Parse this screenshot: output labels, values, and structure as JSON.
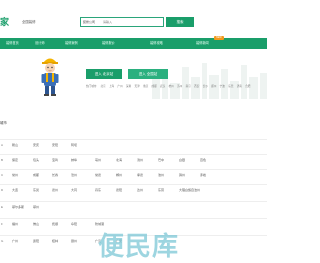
{
  "header": {
    "logo": "家",
    "city_pick": "全国装修",
    "search_category": "装修公司",
    "search_placeholder": "请输入",
    "search_button": "搜索"
  },
  "nav": {
    "items": [
      "装修首页",
      "设计师",
      "装修案例",
      "装修报价",
      "装修攻略",
      "装修新闻"
    ],
    "badge": "NEW"
  },
  "hero": {
    "cta_primary": "进入 北京站",
    "cta_secondary": "进入 全国站",
    "hot_cities": [
      "热门城市:",
      "北京",
      "上海",
      "广州",
      "深圳",
      "天津",
      "重庆",
      "成都",
      "武汉",
      "杭州",
      "苏州",
      "南京",
      "西安",
      "长沙",
      "郑州",
      "宁波",
      "东莞",
      "济南",
      "合肥"
    ]
  },
  "cities": {
    "title": "城市",
    "rows": [
      {
        "letter": "A",
        "cities": [
          "鞍山",
          "安庆",
          "安阳",
          "阿坝"
        ]
      },
      {
        "letter": "B",
        "cities": [
          "保定",
          "包头",
          "宝鸡",
          "蚌埠",
          "亳州",
          "北海",
          "滨州",
          "巴中",
          "白银",
          "百色"
        ]
      },
      {
        "letter": "C",
        "cities": [
          "常州",
          "成都",
          "长春",
          "沧州",
          "常德",
          "郴州",
          "承德",
          "池州",
          "滁州",
          "赤峰"
        ]
      },
      {
        "letter": "D",
        "cities": [
          "大连",
          "东莞",
          "德州",
          "大同",
          "丹东",
          "德阳",
          "达州",
          "东营",
          "大理白族自治州"
        ]
      },
      {
        "letter": "E",
        "cities": [
          "鄂尔多斯",
          "鄂州"
        ]
      },
      {
        "letter": "F",
        "cities": [
          "福州",
          "佛山",
          "抚顺",
          "阜阳",
          "防城港"
        ]
      },
      {
        "letter": "G",
        "cities": [
          "广州",
          "贵阳",
          "桂林",
          "赣州",
          "广元",
          "广安"
        ]
      }
    ]
  },
  "watermark": "便民库"
}
